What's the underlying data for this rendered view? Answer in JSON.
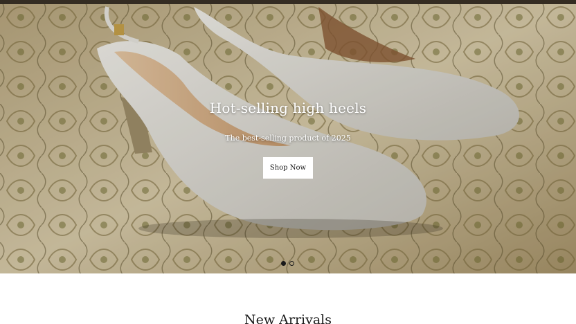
{
  "hero": {
    "title": "Hot-selling high heels",
    "subtitle": "The best-selling product of 2025",
    "cta_label": "Shop Now",
    "slide_count": 2,
    "active_slide": 1
  },
  "sections": {
    "new_arrivals_title": "New Arrivals"
  },
  "colors": {
    "hero_text": "#ffffff",
    "button_bg": "#ffffff",
    "button_text": "#1a1a1a",
    "heading_text": "#1a1a1a",
    "dot_active": "#1a1a1a"
  }
}
